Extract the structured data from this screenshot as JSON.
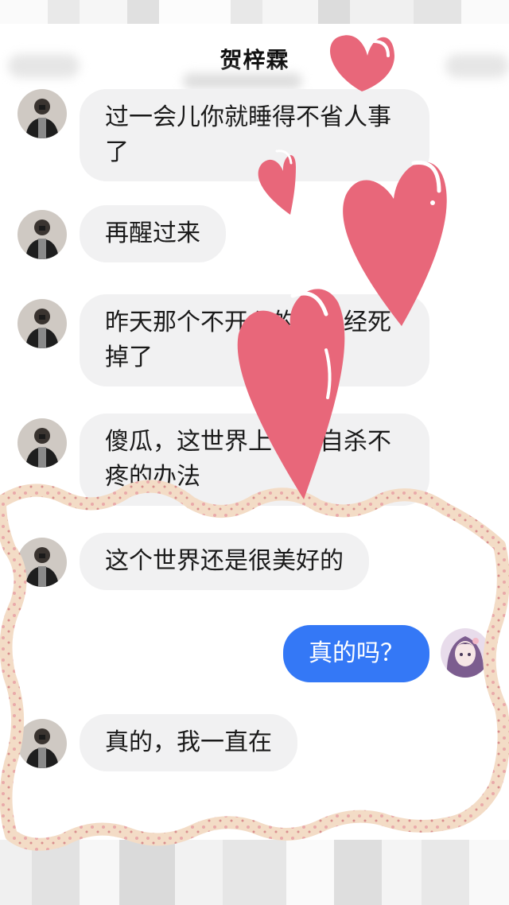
{
  "header": {
    "title": "贺梓霖"
  },
  "messages": [
    {
      "side": "left",
      "text": "过一会儿你就睡得不省人事\n了"
    },
    {
      "side": "left",
      "text": "再醒过来"
    },
    {
      "side": "left",
      "text": "昨天那个不开心的人已经死\n掉了"
    },
    {
      "side": "left",
      "text": "傻瓜，这世界上哪有自杀不\n疼的办法"
    },
    {
      "side": "left",
      "text": "这个世界还是很美好的"
    },
    {
      "side": "right",
      "text": "真的吗？"
    },
    {
      "side": "left",
      "text": "真的，我一直在"
    }
  ],
  "colors": {
    "bubble_other": "#f1f1f2",
    "bubble_self": "#3478f6",
    "heart": "#e8677a",
    "frame": "#f3dcc6",
    "frame_dots": "#e9a9a9"
  },
  "icons": {
    "contact_avatar": "man-in-black-jacket",
    "self_avatar": "anime-girl-purple"
  }
}
